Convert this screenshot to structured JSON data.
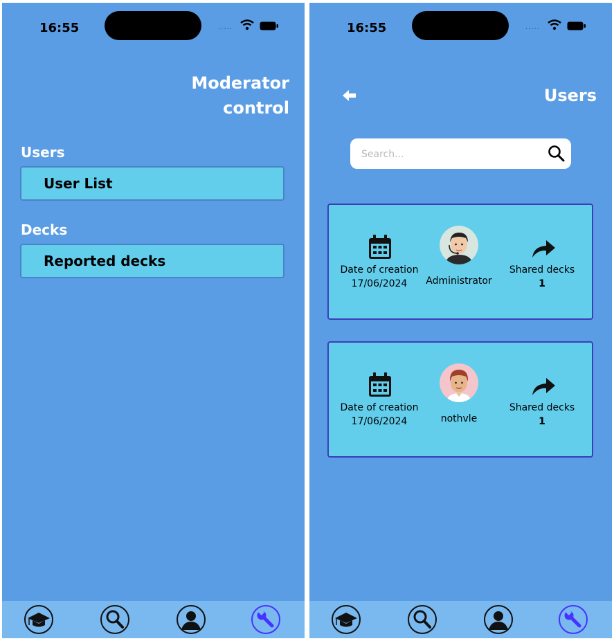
{
  "status_bar": {
    "time": "16:55",
    "signal_dots": "....."
  },
  "moderator_screen": {
    "title_line1": "Moderator",
    "title_line2": "control",
    "sections": [
      {
        "label": "Users",
        "button_label": "User List"
      },
      {
        "label": "Decks",
        "button_label": "Reported decks"
      }
    ]
  },
  "users_screen": {
    "title": "Users",
    "search": {
      "placeholder": "Search...",
      "value": ""
    },
    "users": [
      {
        "date_label": "Date of creation",
        "date_value": "17/06/2024",
        "username": "Administrator",
        "shared_label": "Shared decks",
        "shared_count": "1",
        "avatar_icon": "admin-avatar"
      },
      {
        "date_label": "Date of creation",
        "date_value": "17/06/2024",
        "username": "nothvle",
        "shared_label": "Shared decks",
        "shared_count": "1",
        "avatar_icon": "user-avatar"
      }
    ]
  },
  "tab_bar": {
    "tabs": [
      {
        "icon": "graduation-cap-icon"
      },
      {
        "icon": "search-icon"
      },
      {
        "icon": "profile-icon"
      },
      {
        "icon": "wrench-icon",
        "active": true
      }
    ]
  },
  "colors": {
    "background": "#5b9de4",
    "button_fill": "#62ceec",
    "tab_bar": "#7ab9f0",
    "active_tab": "#4533ff",
    "card_border": "#3a3fb8"
  }
}
